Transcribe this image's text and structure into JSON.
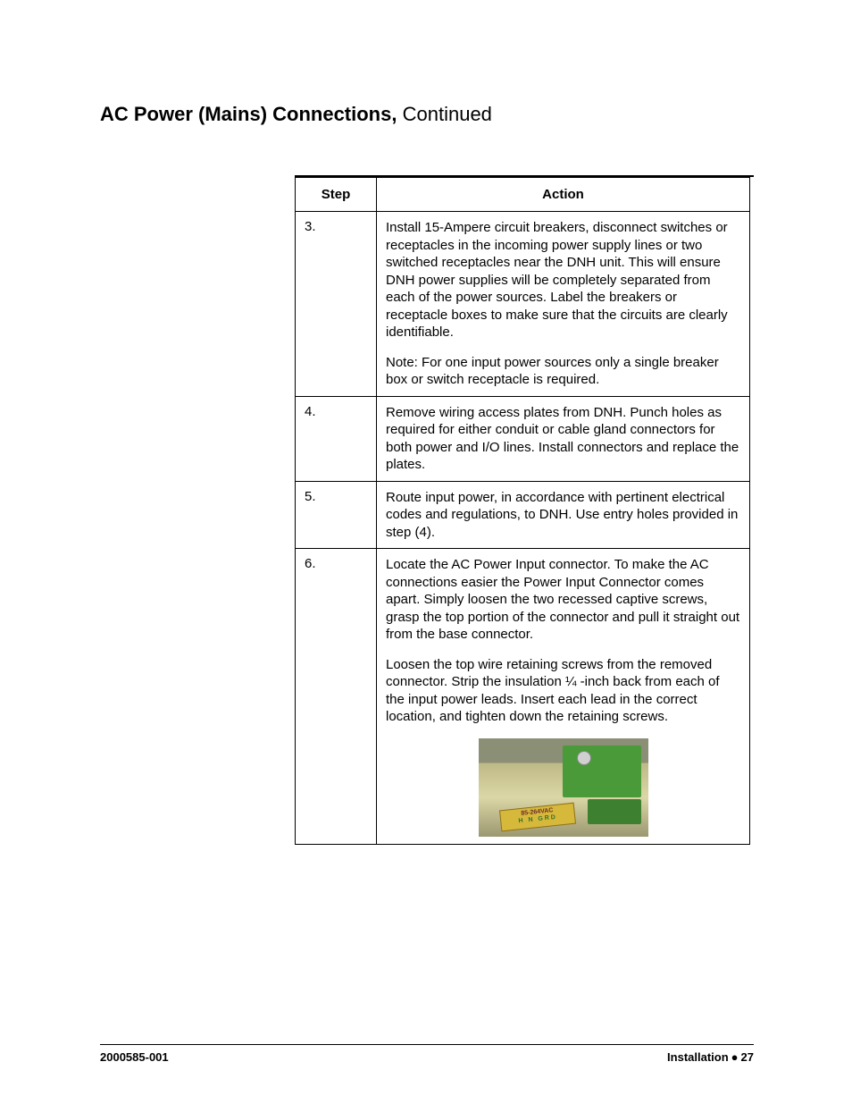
{
  "heading": {
    "title": "AC Power (Mains) Connections,",
    "continued": "Continued"
  },
  "table": {
    "headers": {
      "step": "Step",
      "action": "Action"
    },
    "rows": [
      {
        "step": "3.",
        "paragraphs": [
          "Install 15-Ampere circuit breakers, disconnect switches or receptacles in the incoming power supply lines or two switched receptacles near the DNH unit. This will ensure DNH power supplies will be completely separated from each of the power sources. Label the breakers or receptacle boxes to make sure that the circuits are clearly identifiable.",
          "Note: For one input power sources only a single breaker box or switch receptacle is required."
        ],
        "has_image": false
      },
      {
        "step": "4.",
        "paragraphs": [
          "Remove wiring access plates from DNH. Punch holes as required for either conduit or cable gland connectors for both power and I/O lines. Install connectors and replace the plates."
        ],
        "has_image": false
      },
      {
        "step": "5.",
        "paragraphs": [
          "Route input power, in accordance with pertinent electrical codes and regulations, to DNH. Use entry holes provided in step (4)."
        ],
        "has_image": false
      },
      {
        "step": "6.",
        "paragraphs": [
          "Locate the AC Power Input connector. To make the AC connections easier the Power Input Connector comes apart. Simply loosen the two recessed captive screws, grasp the top portion of the connector and pull it straight out from the base connector.",
          "Loosen the top wire retaining screws from the removed connector. Strip the insulation ¼ -inch back from each of the input power leads. Insert each lead in the correct location, and tighten down the retaining screws."
        ],
        "has_image": true,
        "image_label": {
          "line1": "85-264VAC",
          "line2": "H N GRD"
        }
      }
    ]
  },
  "footer": {
    "left": "2000585-001",
    "right_section": "Installation",
    "right_page": "27"
  }
}
